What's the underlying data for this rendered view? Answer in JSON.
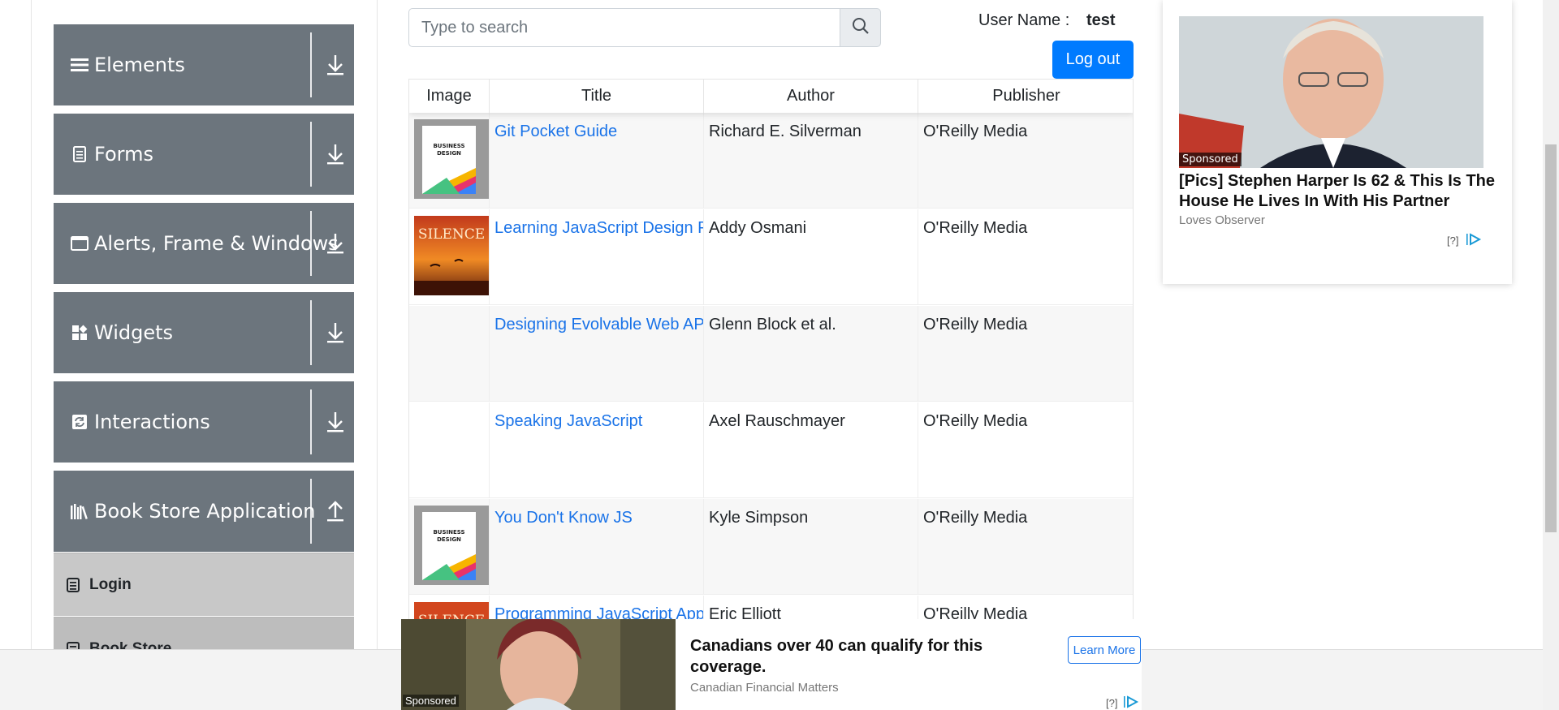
{
  "sidebar": {
    "groups": [
      {
        "label": "Elements",
        "icon": "hamburger-icon",
        "state": "collapsed"
      },
      {
        "label": "Forms",
        "icon": "document-icon",
        "state": "collapsed"
      },
      {
        "label": "Alerts, Frame & Windows",
        "icon": "window-icon",
        "state": "collapsed"
      },
      {
        "label": "Widgets",
        "icon": "widgets-icon",
        "state": "collapsed"
      },
      {
        "label": "Interactions",
        "icon": "sync-icon",
        "state": "collapsed"
      },
      {
        "label": "Book Store Application",
        "icon": "books-icon",
        "state": "expanded"
      }
    ],
    "sub_items": [
      {
        "label": "Login"
      },
      {
        "label": "Book Store"
      }
    ]
  },
  "search": {
    "placeholder": "Type to search",
    "value": ""
  },
  "user": {
    "label": "User Name :",
    "value": "test",
    "logout_label": "Log out"
  },
  "table": {
    "headers": [
      "Image",
      "Title",
      "Author",
      "Publisher"
    ],
    "rows": [
      {
        "cover": "business-design",
        "title": "Git Pocket Guide",
        "author": "Richard E. Silverman",
        "publisher": "O'Reilly Media"
      },
      {
        "cover": "silence",
        "title": "Learning JavaScript Design Patterns",
        "author": "Addy Osmani",
        "publisher": "O'Reilly Media"
      },
      {
        "cover": "none",
        "title": "Designing Evolvable Web APIs with ASP.NET",
        "author": "Glenn Block et al.",
        "publisher": "O'Reilly Media"
      },
      {
        "cover": "none",
        "title": "Speaking JavaScript",
        "author": "Axel Rauschmayer",
        "publisher": "O'Reilly Media"
      },
      {
        "cover": "business-design",
        "title": "You Don't Know JS",
        "author": "Kyle Simpson",
        "publisher": "O'Reilly Media"
      },
      {
        "cover": "silence",
        "title": "Programming JavaScript Applications",
        "author": "Eric Elliott",
        "publisher": "O'Reilly Media"
      }
    ]
  },
  "ad_right": {
    "sponsored": "Sponsored",
    "headline": "[Pics] Stephen Harper Is 62 & This Is The House He Lives In With His Partner",
    "source": "Loves Observer",
    "adchoice": "[?]"
  },
  "ad_bottom": {
    "sponsored": "Sponsored",
    "headline": "Canadians over 40 can qualify for this coverage.",
    "source": "Canadian Financial Matters",
    "cta": "Learn More",
    "adchoice": "[?]"
  },
  "cover_texts": {
    "business": "BUSINESS DESIGN",
    "silence": "SILENCE"
  },
  "colors": {
    "sidebar_header": "#6c757d",
    "sub_item": "#c8c8c8",
    "link": "#1a73e8",
    "primary_button": "#007bff"
  }
}
